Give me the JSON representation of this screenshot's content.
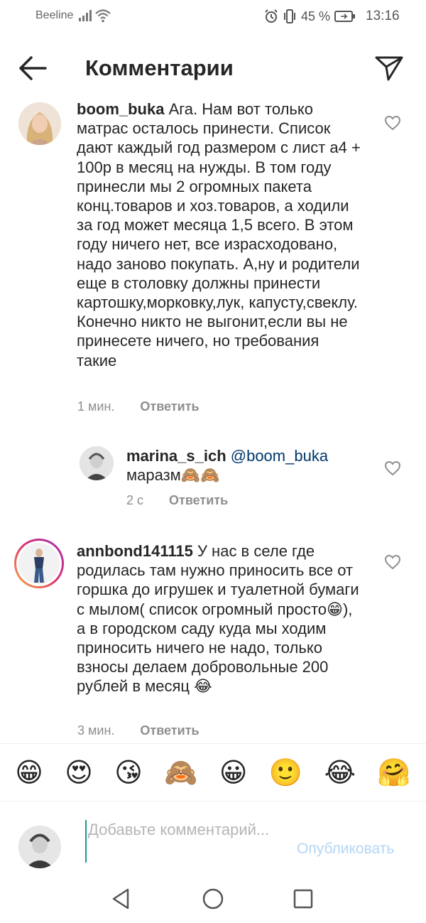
{
  "status_bar": {
    "carrier": "Beeline",
    "battery": "45 %",
    "time": "13:16",
    "icons": [
      "signal-icon",
      "wifi-icon",
      "alarm-icon",
      "vibrate-icon",
      "battery-icon"
    ]
  },
  "header": {
    "title": "Комментарии",
    "back_icon": "arrow-left-icon",
    "share_icon": "paper-plane-icon"
  },
  "comments": [
    {
      "username": "boom_buka",
      "mention": "",
      "text": " Ага. Нам вот только матрас осталось принести. Список дают каждый год размером с лист а4 + 100р в месяц на нужды. В том году принесли мы 2 огромных пакета конц.товаров и хоз.товаров, а ходили за год может месяца 1,5 всего. В этом году ничего нет, все израсходовано, надо заново покупать. А,ну и родители еще в столовку должны принести картошку,морковку,лук, капусту,свеклу. Конечно никто не выгонит,если вы не принесете ничего, но требования такие",
      "time": "1 мин.",
      "reply": "Ответить"
    },
    {
      "username": "marina_s_ich",
      "mention": " @boom_buka",
      "text": "маразм🙈🙈",
      "time": "2 с",
      "reply": "Ответить"
    },
    {
      "username": "annbond141115",
      "mention": "",
      "text": " У нас в селе где родилась там нужно приносить все от горшка до игрушек и туалетной бумаги с мылом( список огромный просто😁), а в городском саду куда мы ходим  приносить ничего не надо, только взносы делаем добровольные 200 рублей в месяц 😂",
      "time": "3 мин.",
      "reply": "Ответить"
    }
  ],
  "emoji_bar": [
    "😁",
    "😍",
    "😘",
    "🙈",
    "😀",
    "🙂",
    "😂",
    "🤗"
  ],
  "input": {
    "placeholder": "Добавьте комментарий...",
    "value": "",
    "publish": "Опубликовать"
  },
  "nav": [
    "back-triangle-icon",
    "home-circle-icon",
    "recents-square-icon"
  ]
}
